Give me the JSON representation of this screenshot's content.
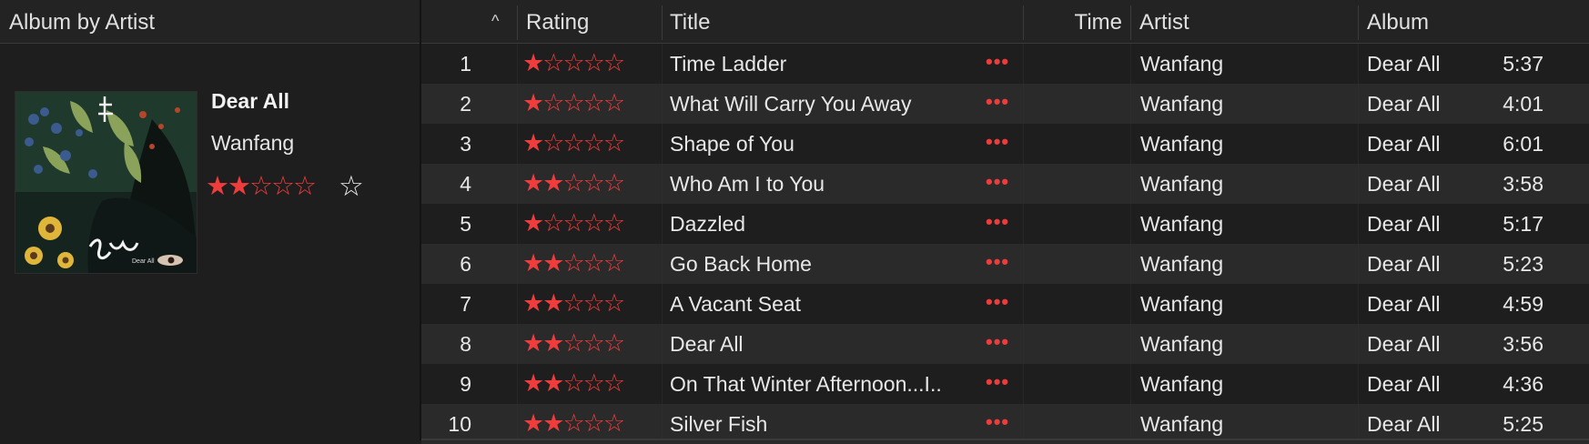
{
  "header": {
    "album_by_artist": "Album by Artist",
    "sort_indicator": "^",
    "rating": "Rating",
    "title": "Title",
    "time": "Time",
    "artist": "Artist",
    "album": "Album"
  },
  "album": {
    "title": "Dear All",
    "artist": "Wanfang",
    "rating": 2,
    "max_rating": 5,
    "cover_caption": "Dear All"
  },
  "colors": {
    "star_accent": "#ef3d3d",
    "more_dots": "#ee3c3c",
    "background": "#1e1e1e",
    "alt_row": "#2a2a2a"
  },
  "icons": {
    "sort": "chevron-up-icon",
    "more": "more-horizontal-icon",
    "favorite": "star-outline-icon",
    "star_filled": "star-filled-icon",
    "star_empty": "star-outline-icon"
  },
  "tracks": [
    {
      "num": "1",
      "rating": 1,
      "title": "Time Ladder",
      "more": "•••",
      "time": "5:37",
      "artist": "Wanfang",
      "album": "Dear All"
    },
    {
      "num": "2",
      "rating": 1,
      "title": "What Will Carry You Away",
      "more": "•••",
      "time": "4:01",
      "artist": "Wanfang",
      "album": "Dear All"
    },
    {
      "num": "3",
      "rating": 1,
      "title": "Shape of You",
      "more": "•••",
      "time": "6:01",
      "artist": "Wanfang",
      "album": "Dear All"
    },
    {
      "num": "4",
      "rating": 2,
      "title": "Who Am I to You",
      "more": "•••",
      "time": "3:58",
      "artist": "Wanfang",
      "album": "Dear All"
    },
    {
      "num": "5",
      "rating": 1,
      "title": "Dazzled",
      "more": "•••",
      "time": "5:17",
      "artist": "Wanfang",
      "album": "Dear All"
    },
    {
      "num": "6",
      "rating": 2,
      "title": "Go Back Home",
      "more": "•••",
      "time": "5:23",
      "artist": "Wanfang",
      "album": "Dear All"
    },
    {
      "num": "7",
      "rating": 2,
      "title": "A Vacant Seat",
      "more": "•••",
      "time": "4:59",
      "artist": "Wanfang",
      "album": "Dear All"
    },
    {
      "num": "8",
      "rating": 2,
      "title": "Dear All",
      "more": "•••",
      "time": "3:56",
      "artist": "Wanfang",
      "album": "Dear All"
    },
    {
      "num": "9",
      "rating": 2,
      "title": "On That Winter Afternoon...I...",
      "more": "•••",
      "time": "4:36",
      "artist": "Wanfang",
      "album": "Dear All"
    },
    {
      "num": "10",
      "rating": 2,
      "title": "Silver Fish",
      "more": "•••",
      "time": "5:25",
      "artist": "Wanfang",
      "album": "Dear All"
    }
  ]
}
